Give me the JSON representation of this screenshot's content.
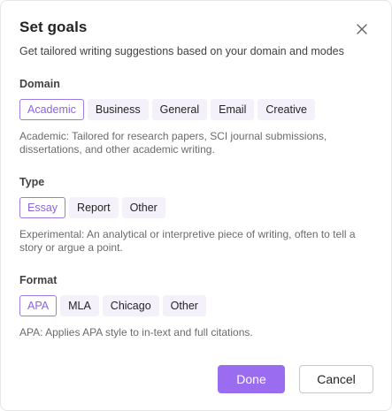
{
  "dialog": {
    "title": "Set goals",
    "subtitle": "Get tailored writing suggestions based on your domain and modes",
    "close_icon": "close-icon"
  },
  "sections": {
    "domain": {
      "label": "Domain",
      "options": [
        "Academic",
        "Business",
        "General",
        "Email",
        "Creative"
      ],
      "selected": "Academic",
      "description": "Academic: Tailored for research papers, SCI journal submissions, dissertations, and other academic writing."
    },
    "type": {
      "label": "Type",
      "options": [
        "Essay",
        "Report",
        "Other"
      ],
      "selected": "Essay",
      "description": "Experimental: An analytical or interpretive piece of writing, often to tell a story or argue a point."
    },
    "format": {
      "label": "Format",
      "options": [
        "APA",
        "MLA",
        "Chicago",
        "Other"
      ],
      "selected": "APA",
      "description": "APA: Applies APA style to in-text and full citations."
    }
  },
  "actions": {
    "done_label": "Done",
    "cancel_label": "Cancel"
  },
  "colors": {
    "accent": "#9a6cf0",
    "chip_bg": "#f4f1fb",
    "selected_border": "#9b7be4"
  }
}
